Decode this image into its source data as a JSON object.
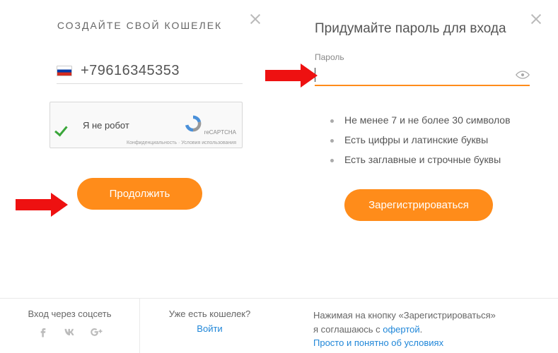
{
  "left": {
    "title": "СОЗДАЙТЕ СВОЙ КОШЕЛЕК",
    "phone": "+79616345353",
    "captcha": {
      "label": "Я не робот",
      "brand": "reCAPTCHA",
      "privacy": "Конфиденциальность",
      "terms": "Условия использования"
    },
    "continue_btn": "Продолжить",
    "footer": {
      "social_title": "Вход через соцсеть",
      "have_wallet": "Уже есть кошелек?",
      "login": "Войти"
    }
  },
  "right": {
    "title": "Придумайте пароль для входа",
    "pw_label": "Пароль",
    "requirements": [
      "Не менее 7 и не более 30 символов",
      "Есть цифры и латинские буквы",
      "Есть заглавные и строчные буквы"
    ],
    "register_btn": "Зарегистрироваться",
    "footer": {
      "line1a": "Нажимая на кнопку «Зарегистрироваться»",
      "line1b": "я соглашаюсь с ",
      "offer": "офертой",
      "line2": "Просто и понятно об условиях"
    }
  }
}
